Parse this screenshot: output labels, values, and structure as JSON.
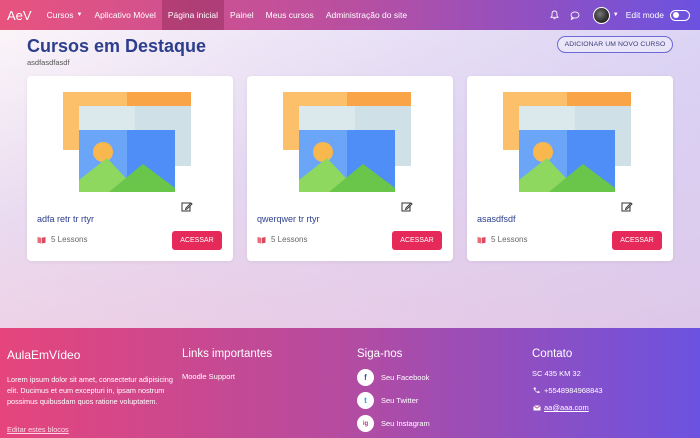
{
  "navbar": {
    "brand": "AeV",
    "items": [
      {
        "label": "Cursos",
        "has_dropdown": true
      },
      {
        "label": "Aplicativo Móvel"
      },
      {
        "label": "Página inicial",
        "active": true
      },
      {
        "label": "Painel"
      },
      {
        "label": "Meus cursos"
      },
      {
        "label": "Administração do site"
      }
    ],
    "edit_mode_label": "Edit mode",
    "icons": [
      "bell-icon",
      "chat-icon",
      "avatar",
      "chevron-down-icon",
      "toggle-switch"
    ]
  },
  "main": {
    "title": "Cursos em Destaque",
    "subtitle": "asdfasdfasdf",
    "add_course_label": "ADICIONAR UM NOVO CURSO",
    "cards": [
      {
        "title": "adfa retr tr rtyr",
        "lessons": "5 Lessons",
        "button": "ACESSAR"
      },
      {
        "title": "qwerqwer tr rtyr",
        "lessons": "5 Lessons",
        "button": "ACESSAR"
      },
      {
        "title": "asasdfsdf",
        "lessons": "5 Lessons",
        "button": "ACESSAR"
      }
    ]
  },
  "footer": {
    "brand": "AulaEmVídeo",
    "about": "Lorem ipsum dolor sit amet, consectetur adipisicing elit. Ducimus et eum excepturi in, ipsam nostrum possimus quibusdam quos ratione voluptatem.",
    "edit_blocks": "Editar estes blocos",
    "links_title": "Links importantes",
    "links": [
      "Moodle Support"
    ],
    "social_title": "Siga-nos",
    "social": [
      {
        "icon": "f",
        "label": "Seu Facebook"
      },
      {
        "icon": "t",
        "label": "Seu Twitter"
      },
      {
        "icon": "ig",
        "label": "Seu Instagram"
      }
    ],
    "contact_title": "Contato",
    "contact": {
      "address": "SC 435 KM 32",
      "phone": "+5548984968843",
      "email": "aa@aaa.com"
    }
  },
  "colors": {
    "accent": "#e52a5a",
    "title": "#2c3e8c",
    "nav_gradient_start": "#e8537e",
    "nav_gradient_end": "#6b52e0"
  }
}
